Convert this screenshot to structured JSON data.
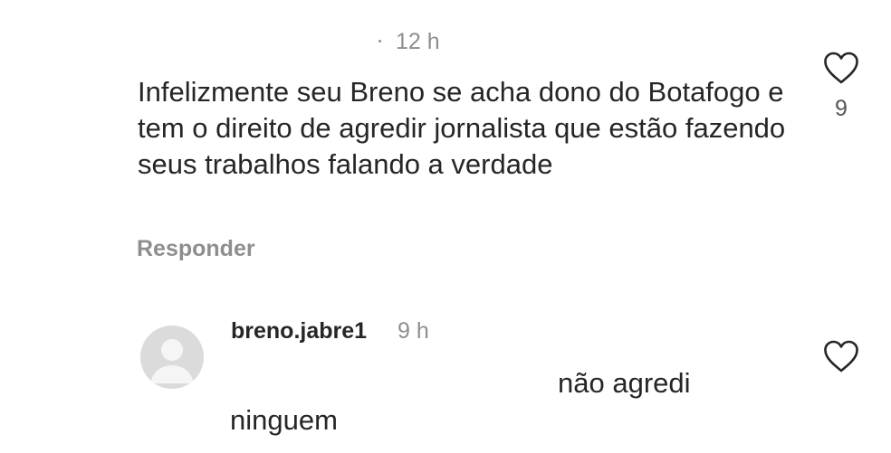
{
  "comment": {
    "time": "12 h",
    "text": "Infelizmente seu Breno se acha dono do Botafogo e tem o direito de agredir jornalista que estão fazendo seus trabalhos falando a verdade",
    "reply_label": "Responder",
    "likes": "9",
    "like_icon": "heart-outline-icon"
  },
  "reply": {
    "username": "breno.jabre1",
    "time": "9 h",
    "text_line1": "não agredi",
    "text_line2": "ninguem",
    "avatar_icon": "default-avatar-icon",
    "like_icon": "heart-outline-icon"
  },
  "colors": {
    "text": "#262626",
    "secondary": "#8e8e8e",
    "avatar_bg": "#dbdbdb"
  }
}
